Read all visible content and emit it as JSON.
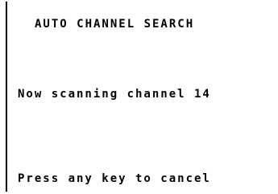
{
  "screen": {
    "title": "AUTO CHANNEL SEARCH",
    "status": "Now scanning channel 14",
    "hint": "Press any key to cancel"
  }
}
